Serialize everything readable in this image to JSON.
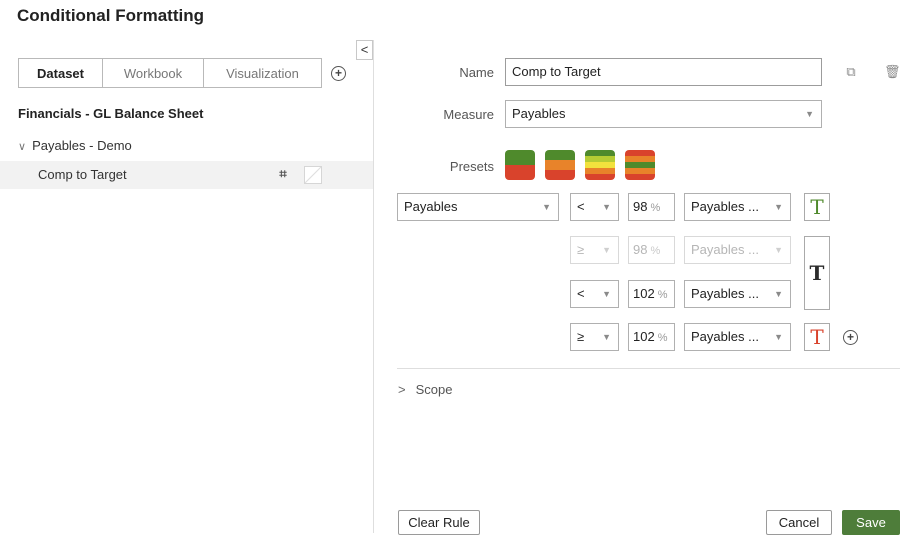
{
  "page": {
    "title": "Conditional Formatting",
    "collapse_glyph": "<"
  },
  "tabs": [
    {
      "label": "Dataset",
      "active": true
    },
    {
      "label": "Workbook",
      "active": false
    },
    {
      "label": "Visualization",
      "active": false
    }
  ],
  "add_icon_glyph": "+",
  "dataset_name": "Financials - GL Balance Sheet",
  "tree": {
    "parent_label": "Payables - Demo",
    "parent_chevron": "∨",
    "child_label": "Comp to Target",
    "child_icon_glyph": "⌗"
  },
  "form": {
    "name_label": "Name",
    "name_value": "Comp to Target",
    "measure_label": "Measure",
    "measure_value": "Payables",
    "presets_label": "Presets",
    "copy_icon": "⧉",
    "trash_icon": "🗑"
  },
  "presets": [
    {
      "colors": [
        "#4f8a2c",
        "#d9432c"
      ]
    },
    {
      "colors": [
        "#4f8a2c",
        "#e8832a",
        "#d9432c"
      ]
    },
    {
      "colors": [
        "#4f8a2c",
        "#b6cc34",
        "#f2e23d",
        "#e8832a",
        "#d9432c"
      ]
    },
    {
      "colors": [
        "#d9432c",
        "#e8832a",
        "#4f8a2c",
        "#e8832a",
        "#d9432c"
      ]
    }
  ],
  "rules": {
    "measure_select": "Payables",
    "rows": [
      {
        "operator": "<",
        "value": "98",
        "pct": "%",
        "color_select": "Payables ...",
        "disabled": false
      },
      {
        "operator": "≥",
        "value": "98",
        "pct": "%",
        "color_select": "Payables ...",
        "disabled": true
      },
      {
        "operator": "<",
        "value": "102",
        "pct": "%",
        "color_select": "Payables ...",
        "disabled": false
      },
      {
        "operator": "≥",
        "value": "102",
        "pct": "%",
        "color_select": "Payables ...",
        "disabled": false
      }
    ],
    "t_glyph": "T",
    "t_colors": {
      "first": "#4f8a2c",
      "middle": "#111111",
      "last": "#d9432c"
    }
  },
  "scope": {
    "label": "Scope",
    "chevron": ">"
  },
  "footer": {
    "clear_label": "Clear Rule",
    "cancel_label": "Cancel",
    "save_label": "Save"
  },
  "caret_glyph": "▼"
}
